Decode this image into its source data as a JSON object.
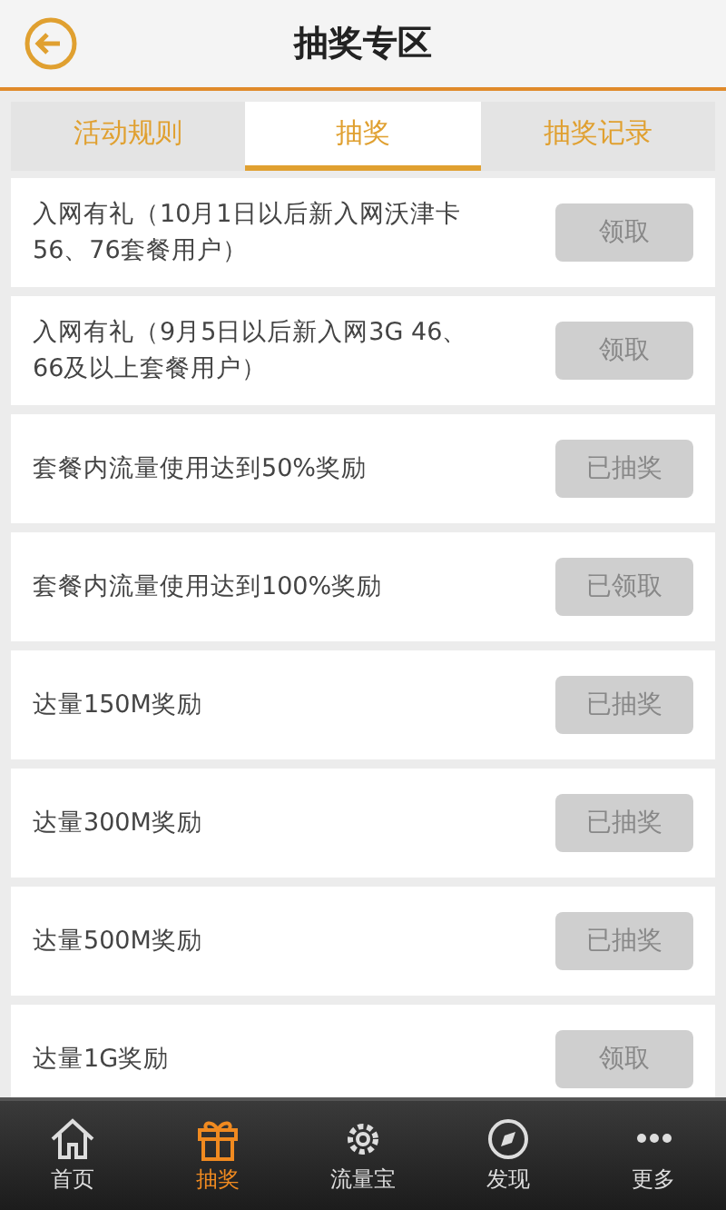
{
  "header": {
    "title": "抽奖专区"
  },
  "tabs": [
    {
      "label": "活动规则",
      "selected": false
    },
    {
      "label": "抽奖",
      "selected": true
    },
    {
      "label": "抽奖记录",
      "selected": false
    }
  ],
  "rewards": [
    {
      "text": "入网有礼（10月1日以后新入网沃津卡56、76套餐用户）",
      "button": "领取"
    },
    {
      "text": "入网有礼（9月5日以后新入网3G 46、66及以上套餐用户）",
      "button": "领取"
    },
    {
      "text": "套餐内流量使用达到50%奖励",
      "button": "已抽奖"
    },
    {
      "text": "套餐内流量使用达到100%奖励",
      "button": "已领取"
    },
    {
      "text": "达量150M奖励",
      "button": "已抽奖"
    },
    {
      "text": "达量300M奖励",
      "button": "已抽奖"
    },
    {
      "text": "达量500M奖励",
      "button": "已抽奖"
    },
    {
      "text": "达量1G奖励",
      "button": "领取"
    }
  ],
  "nav": [
    {
      "label": "首页",
      "kind": "home",
      "selected": false
    },
    {
      "label": "抽奖",
      "kind": "gift",
      "selected": true
    },
    {
      "label": "流量宝",
      "kind": "gear",
      "selected": false
    },
    {
      "label": "发现",
      "kind": "compass",
      "selected": false
    },
    {
      "label": "更多",
      "kind": "more",
      "selected": false
    }
  ]
}
